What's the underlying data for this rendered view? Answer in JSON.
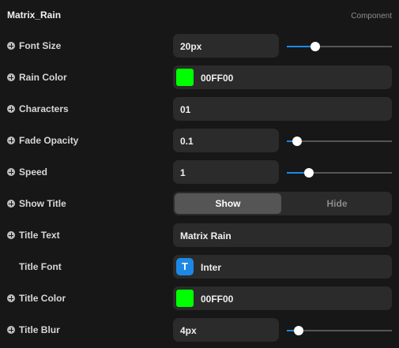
{
  "panel": {
    "title": "Matrix_Rain",
    "type_label": "Component"
  },
  "props": {
    "font_size": {
      "label": "Font Size",
      "value": "20px",
      "level": 0.27
    },
    "rain_color": {
      "label": "Rain Color",
      "value": "00FF00",
      "swatch": "#00ff00"
    },
    "characters": {
      "label": "Characters",
      "value": "01"
    },
    "fade_opacity": {
      "label": "Fade Opacity",
      "value": "0.1",
      "level": 0.1
    },
    "speed": {
      "label": "Speed",
      "value": "1",
      "level": 0.21
    },
    "show_title": {
      "label": "Show Title",
      "options": [
        "Show",
        "Hide"
      ],
      "selected": "Show"
    },
    "title_text": {
      "label": "Title Text",
      "value": "Matrix Rain"
    },
    "title_font": {
      "label": "Title Font",
      "value": "Inter",
      "badge": "T",
      "icon": "font-icon"
    },
    "title_color": {
      "label": "Title Color",
      "value": "00FF00",
      "swatch": "#00ff00"
    },
    "title_blur": {
      "label": "Title Blur",
      "value": "4px",
      "level": 0.11
    }
  },
  "colors": {
    "accent": "#1e88e5",
    "background": "#171717",
    "field": "#2b2b2b"
  }
}
